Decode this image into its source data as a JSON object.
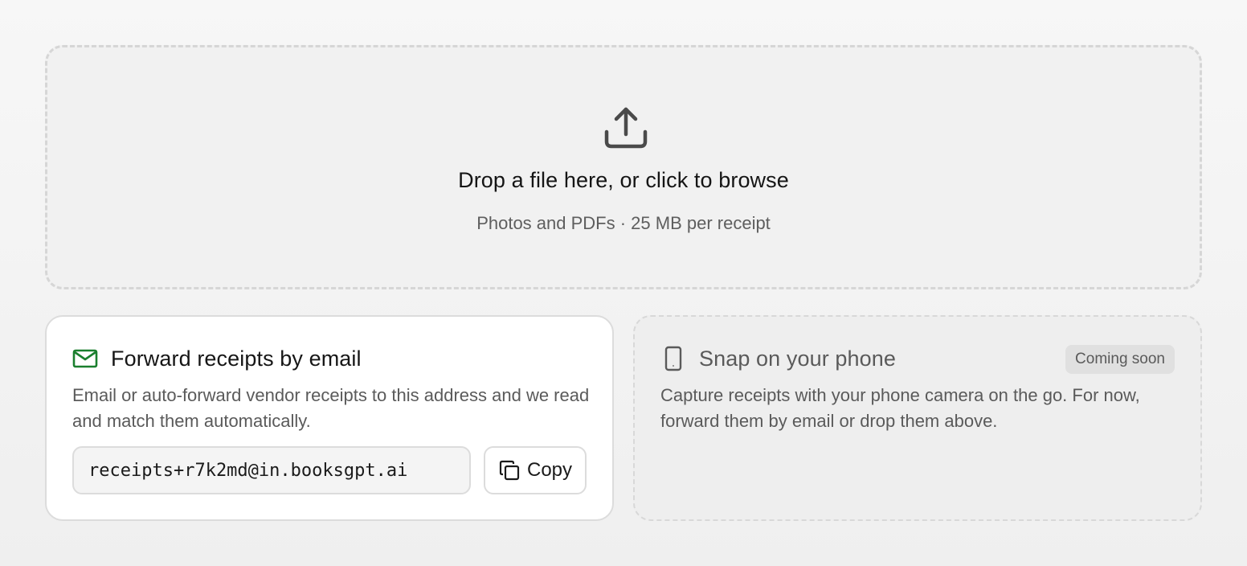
{
  "dropzone": {
    "icon": "upload-icon",
    "title": "Drop a file here, or click to browse",
    "subtitle": "Photos and PDFs · 25 MB per receipt"
  },
  "email_card": {
    "icon": "mail-icon",
    "accent_color": "#1a7f2e",
    "heading": "Forward receipts by email",
    "description": "Email or auto-forward vendor receipts to this address and we read and match them automatically.",
    "address": "receipts+r7k2md@in.booksgpt.ai",
    "copy_icon": "copy-icon",
    "copy_label": "Copy"
  },
  "phone_card": {
    "icon": "phone-icon",
    "heading": "Snap on your phone",
    "badge": "Coming soon",
    "description": "Capture receipts with your phone camera on the go. For now, forward them by email or drop them above."
  }
}
